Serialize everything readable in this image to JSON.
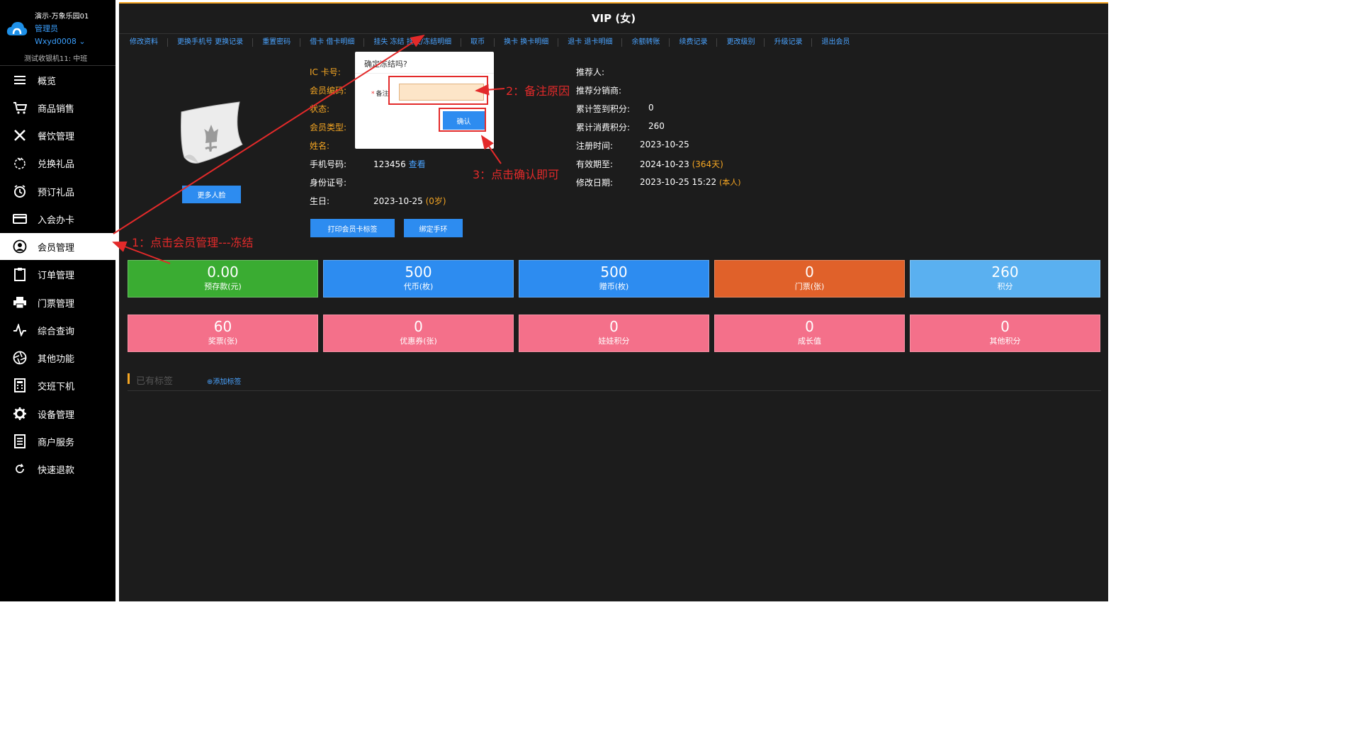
{
  "sidebar": {
    "store_name": "演示-万象乐园01",
    "role": "管理员",
    "username": "Wxyd0008 ⌄",
    "shift": "测试收银机11: 中班",
    "items": [
      {
        "label": "概览",
        "icon": "menu-icon"
      },
      {
        "label": "商品销售",
        "icon": "cart-icon"
      },
      {
        "label": "餐饮管理",
        "icon": "fork-knife-icon"
      },
      {
        "label": "兑换礼品",
        "icon": "gift-icon"
      },
      {
        "label": "预订礼品",
        "icon": "alarm-clock-icon"
      },
      {
        "label": "入会办卡",
        "icon": "card-icon"
      },
      {
        "label": "会员管理",
        "icon": "user-icon",
        "active": true
      },
      {
        "label": "订单管理",
        "icon": "clipboard-icon"
      },
      {
        "label": "门票管理",
        "icon": "printer-icon"
      },
      {
        "label": "综合查询",
        "icon": "pulse-icon"
      },
      {
        "label": "其他功能",
        "icon": "aperture-icon"
      },
      {
        "label": "交班下机",
        "icon": "calculator-icon"
      },
      {
        "label": "设备管理",
        "icon": "gear-icon"
      },
      {
        "label": "商户服务",
        "icon": "document-icon"
      },
      {
        "label": "快速退款",
        "icon": "refresh-icon"
      }
    ]
  },
  "header": {
    "title": "VIP (女)",
    "accent_color": "#f5a623"
  },
  "menu": [
    "修改资料",
    "更换手机号 更换记录",
    "重置密码",
    "借卡 借卡明细",
    "挂失 冻结 挂失/冻结明细",
    "取币",
    "换卡 换卡明细",
    "退卡 退卡明细",
    "余额转账",
    "续费记录",
    "更改级别",
    "升级记录",
    "退出会员"
  ],
  "profile": {
    "more_faces_button": "更多人脸",
    "left_fields": {
      "ic_card": "IC 卡号:",
      "member_code": "会员编码:",
      "status": "状态:",
      "member_type": "会员类型:",
      "name": "姓名:",
      "phone_label": "手机号码:",
      "phone_value": "123456",
      "phone_view": "查看",
      "id_number": "身份证号:",
      "birthday_label": "生日:",
      "birthday_value": "2023-10-25",
      "birthday_age": "(0岁)"
    },
    "right_fields": {
      "referrer": "推荐人:",
      "referrer_distributor": "推荐分销商:",
      "signin_points_label": "累计签到积分:",
      "signin_points_value": "0",
      "consume_points_label": "累计消费积分:",
      "consume_points_value": "260",
      "register_label": "注册时间:",
      "register_value": "2023-10-25",
      "valid_label": "有效期至:",
      "valid_value": "2024-10-23",
      "valid_days": "(364天)",
      "modified_label": "修改日期:",
      "modified_value": "2023-10-25 15:22",
      "modified_by": "(本人)"
    },
    "print_button": "打印会员卡标签",
    "bind_button": "绑定手环"
  },
  "stats_row1": [
    {
      "value": "0.00",
      "label": "预存款(元)",
      "color": "#3aac32"
    },
    {
      "value": "500",
      "label": "代币(枚)",
      "color": "#2d8cf0"
    },
    {
      "value": "500",
      "label": "赠币(枚)",
      "color": "#2d8cf0"
    },
    {
      "value": "0",
      "label": "门票(张)",
      "color": "#e0612a"
    },
    {
      "value": "260",
      "label": "积分",
      "color": "#5ab0f0"
    }
  ],
  "stats_row2": [
    {
      "value": "60",
      "label": "奖票(张)",
      "color": "#f4708a"
    },
    {
      "value": "0",
      "label": "优惠券(张)",
      "color": "#f4708a"
    },
    {
      "value": "0",
      "label": "娃娃积分",
      "color": "#f4708a"
    },
    {
      "value": "0",
      "label": "成长值",
      "color": "#f4708a"
    },
    {
      "value": "0",
      "label": "其他积分",
      "color": "#f4708a"
    }
  ],
  "tags": {
    "title": "已有标签",
    "add_label": "添加标签"
  },
  "dialog": {
    "title": "确定冻结吗?",
    "remark_label": "备注",
    "remark_value": "",
    "confirm": "确认"
  },
  "annotations": {
    "step1": "1：点击会员管理---冻结",
    "step2": "2：备注原因",
    "step3": "3：点击确认即可",
    "color": "#e32a2a"
  }
}
